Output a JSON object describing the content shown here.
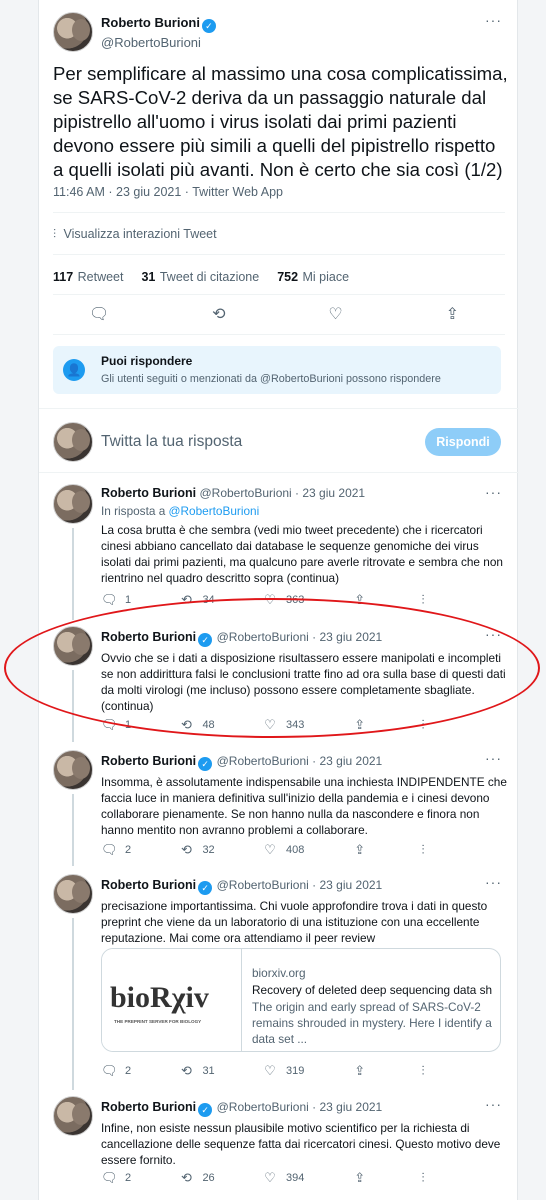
{
  "main_tweet": {
    "name": "Roberto Burioni",
    "handle": "@RobertoBurioni",
    "text": "Per semplificare al massimo una cosa complicatissima, se SARS-CoV-2 deriva da un passaggio naturale dal pipistrello all'uomo i virus isolati dai primi pazienti devono essere più simili a quelli del pipistrello rispetto a quelli isolati più avanti. Non è certo che sia così (1/2)",
    "meta": "11:46 AM · 23 giu 2021 · Twitter Web App",
    "analytics": "Visualizza interazioni Tweet",
    "stats": [
      {
        "num": "117",
        "label": "Retweet"
      },
      {
        "num": "31",
        "label": "Tweet di citazione"
      },
      {
        "num": "752",
        "label": "Mi piace"
      }
    ]
  },
  "notice": {
    "title": "Puoi rispondere",
    "text": "Gli utenti seguiti o menzionati da @RobertoBurioni possono rispondere"
  },
  "composer": {
    "placeholder": "Twitta la tua risposta",
    "button": "Rispondi"
  },
  "replies": [
    {
      "name": "Roberto Burioni",
      "handle": "@RobertoBurioni · 23 giu 2021",
      "in_reply_prefix": "In risposta a",
      "in_reply_handle": "@RobertoBurioni",
      "text": "La cosa brutta è che sembra (vedi mio tweet precedente) che i ricercatori cinesi abbiano cancellato dai database le sequenze genomiche dei virus isolati dai primi pazienti, ma qualcuno pare averle ritrovate e sembra che non rientrino nel quadro descritto sopra (continua)",
      "reply_count": "1",
      "retweet_count": "34",
      "like_count": "363"
    },
    {
      "name": "Roberto Burioni",
      "handle": "@RobertoBurioni · 23 giu 2021",
      "text": "Ovvio che se i dati a disposizione risultassero essere manipolati e incompleti se non addirittura falsi le conclusioni tratte fino ad ora sulla base di questi dati da molti virologi (me incluso) possono essere completamente sbagliate. (continua)",
      "reply_count": "1",
      "retweet_count": "48",
      "like_count": "343"
    },
    {
      "name": "Roberto Burioni",
      "handle": "@RobertoBurioni · 23 giu 2021",
      "text": "Insomma, è assolutamente indispensabile una inchiesta INDIPENDENTE che faccia luce in maniera definitiva sull'inizio della pandemia e i cinesi devono collaborare pienamente. Se non hanno nulla da nascondere e finora non hanno mentito non avranno problemi a collaborare.",
      "reply_count": "2",
      "retweet_count": "32",
      "like_count": "408"
    },
    {
      "name": "Roberto Burioni",
      "handle": "@RobertoBurioni · 23 giu 2021",
      "text": "precisazione importantissima. Chi vuole approfondire trova i dati in questo preprint che viene da un laboratorio di una istituzione con una eccellente reputazione. Mai come ora attendiamo il peer review",
      "reply_count": "2",
      "retweet_count": "31",
      "like_count": "319",
      "card": {
        "logo_text": "bioRχiv",
        "logo_sub": "THE PREPRINT SERVER FOR BIOLOGY",
        "domain": "biorxiv.org",
        "title": "Recovery of deleted deep sequencing data sheds ...",
        "desc": "The origin and early spread of SARS-CoV-2 remains shrouded in mystery. Here I identify a data set ..."
      }
    },
    {
      "name": "Roberto Burioni",
      "handle": "@RobertoBurioni · 23 giu 2021",
      "text": "Infine, non esiste nessun plausibile motivo scientifico per la richiesta di cancellazione delle sequenze fatta dai ricercatori cinesi. Questo motivo deve essere fornito.",
      "reply_count": "2",
      "retweet_count": "26",
      "like_count": "394"
    }
  ],
  "colors": {
    "accent": "#1d9bf0",
    "annotation": "#e0171a"
  },
  "icons": [
    "verified-icon",
    "more-icon",
    "reply-icon",
    "retweet-icon",
    "like-icon",
    "share-icon",
    "analytics-icon",
    "people-icon"
  ]
}
